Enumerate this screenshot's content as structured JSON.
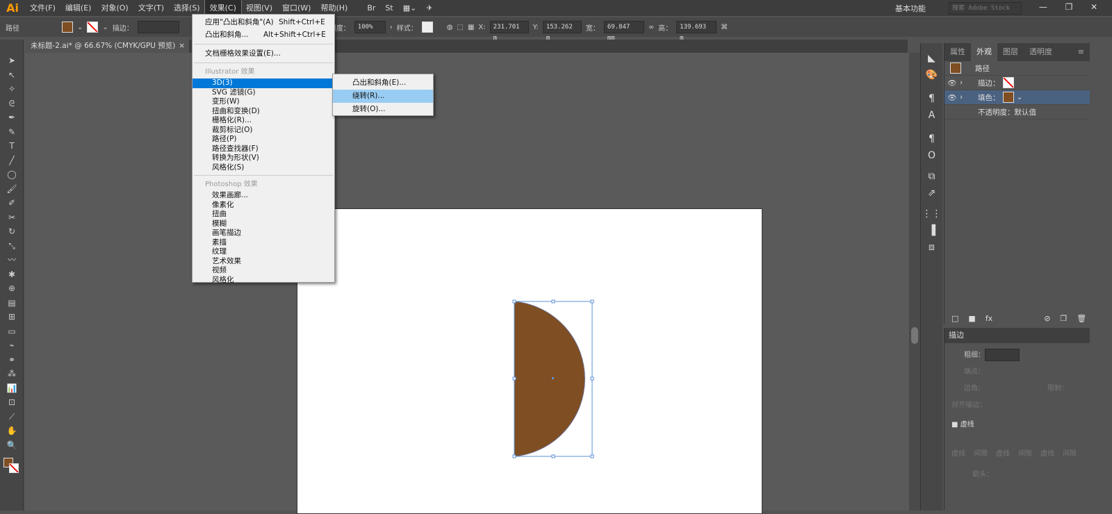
{
  "app": {
    "logo": "Ai"
  },
  "menubar": {
    "items": [
      "文件(F)",
      "编辑(E)",
      "对象(O)",
      "文字(T)",
      "选择(S)",
      "效果(C)",
      "视图(V)",
      "窗口(W)",
      "帮助(H)"
    ],
    "workspace": "基本功能",
    "search_placeholder": "搜索 Adobe Stock"
  },
  "control": {
    "label": "路径",
    "stroke_label": "描边：",
    "opacity_label": "不透明度：",
    "opacity": "100%",
    "style_label": "样式：",
    "x_label": "X:",
    "x": "231.701 m",
    "y_label": "Y:",
    "y": "153.262 m",
    "w_label": "宽：",
    "w": "69.847 mm",
    "h_label": "高：",
    "h": "139.693 m"
  },
  "document": {
    "tab": "未标题-2.ai* @ 66.67% (CMYK/GPU 预览)",
    "close": "×"
  },
  "colors": {
    "fill": "#7f4e22",
    "accent": "#0078d7"
  },
  "effect_menu": {
    "top": [
      {
        "label": "应用\"凸出和斜角\"(A)",
        "shortcut": "Shift+Ctrl+E"
      },
      {
        "label": "凸出和斜角...",
        "shortcut": "Alt+Shift+Ctrl+E"
      }
    ],
    "doc_raster": "文档栅格效果设置(E)...",
    "illustrator_header": "Illustrator 效果",
    "illustrator_items": [
      "3D(3)",
      "SVG 滤镜(G)",
      "变形(W)",
      "扭曲和变换(D)",
      "栅格化(R)...",
      "裁剪标记(O)",
      "路径(P)",
      "路径查找器(F)",
      "转换为形状(V)",
      "风格化(S)"
    ],
    "photoshop_header": "Photoshop 效果",
    "photoshop_items": [
      "效果画廊...",
      "像素化",
      "扭曲",
      "模糊",
      "画笔描边",
      "素描",
      "纹理",
      "艺术效果",
      "视频",
      "风格化"
    ]
  },
  "submenu_3d": [
    "凸出和斜角(E)...",
    "绕转(R)...",
    "旋转(O)..."
  ],
  "panel": {
    "tabs": [
      "属性",
      "外观",
      "图层",
      "透明度"
    ],
    "title": "路径",
    "stroke": "描边：",
    "fill": "填色：",
    "opacity": "不透明度：默认值"
  },
  "stroke_panel": {
    "title": "描边",
    "weight": "粗细：",
    "cap": "端点：",
    "corner": "边角：",
    "limit": "限制：",
    "align": "对齐描边：",
    "dashed": "虚线",
    "dash_labels": [
      "虚线",
      "间隙",
      "虚线",
      "间隙",
      "虚线",
      "间隙"
    ],
    "arrow": "箭头："
  }
}
